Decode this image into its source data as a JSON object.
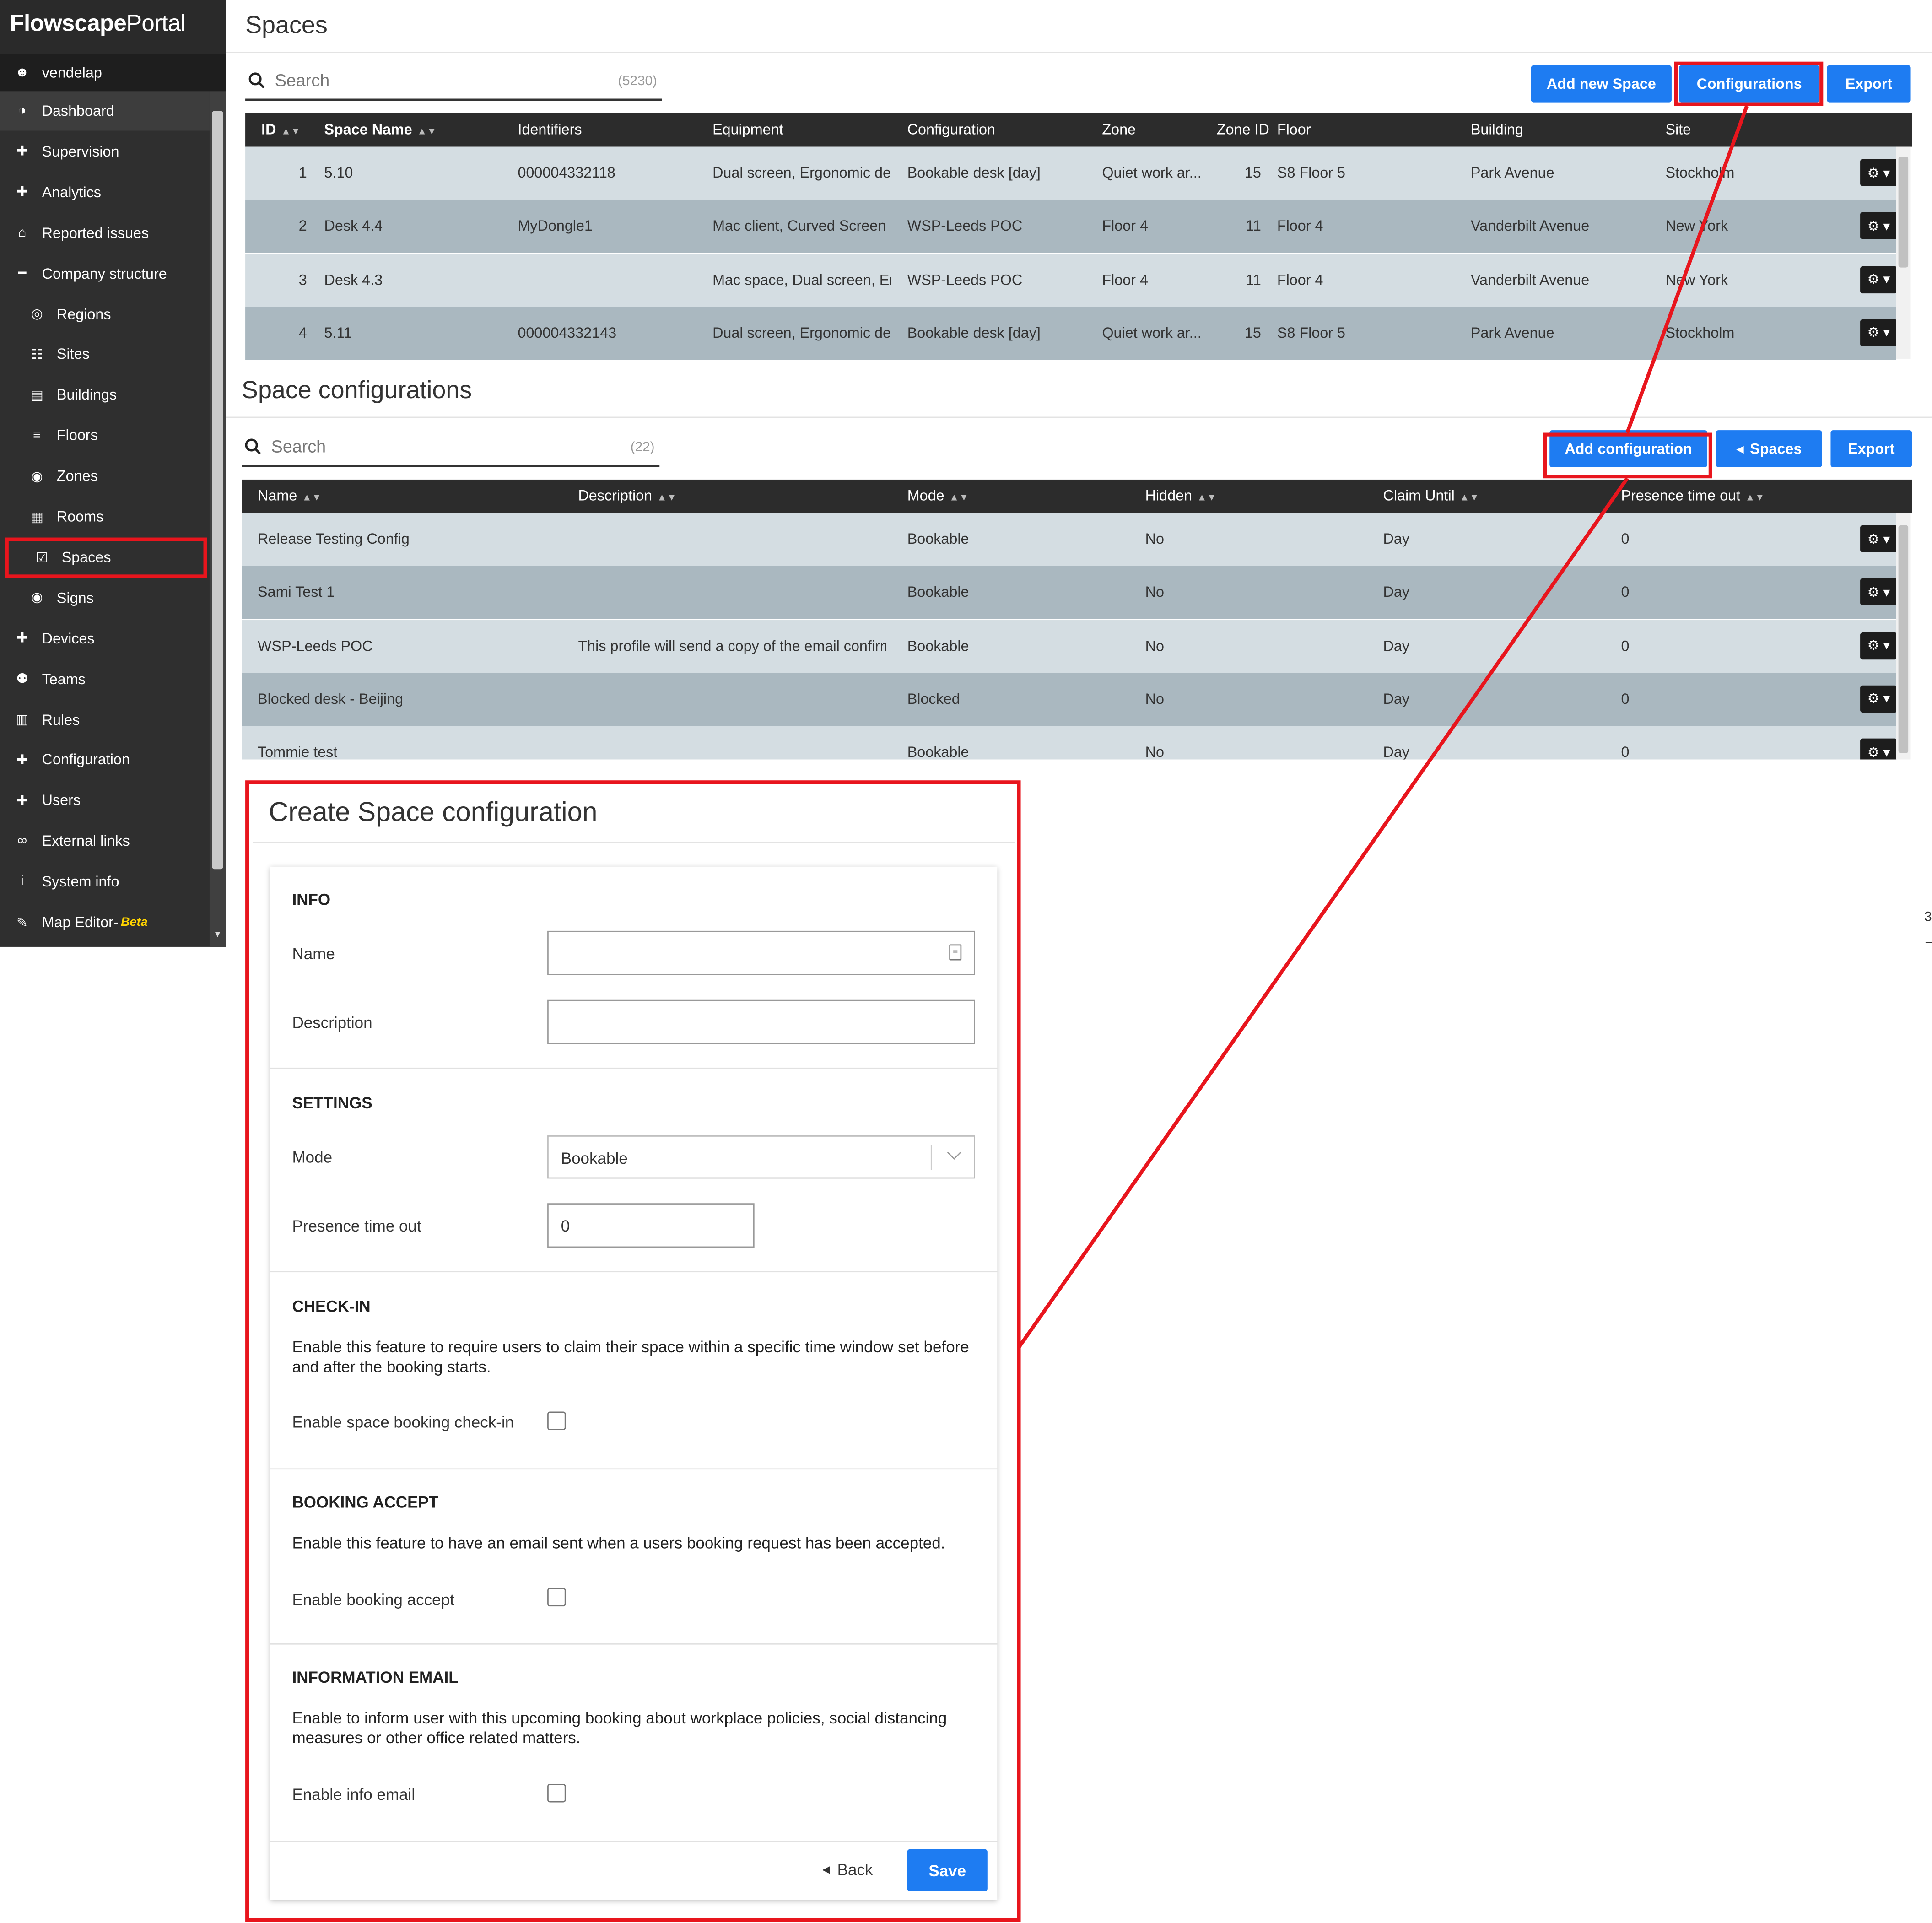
{
  "app": {
    "brand_bold": "Flowscape",
    "brand_light": "Portal",
    "user": "vendelap"
  },
  "sidebar": {
    "items": [
      {
        "label": "Dashboard",
        "icon": "dashboard-icon"
      },
      {
        "label": "Supervision",
        "icon": "plus-icon"
      },
      {
        "label": "Analytics",
        "icon": "plus-icon"
      },
      {
        "label": "Reported issues",
        "icon": "home-icon"
      },
      {
        "label": "Company structure",
        "icon": "minus-icon"
      },
      {
        "label": "Regions",
        "icon": "globe-icon"
      },
      {
        "label": "Sites",
        "icon": "sitemap-icon"
      },
      {
        "label": "Buildings",
        "icon": "building-icon"
      },
      {
        "label": "Floors",
        "icon": "layers-icon"
      },
      {
        "label": "Zones",
        "icon": "map-marker-icon"
      },
      {
        "label": "Rooms",
        "icon": "room-icon"
      },
      {
        "label": "Spaces",
        "icon": "calendar-check-icon"
      },
      {
        "label": "Signs",
        "icon": "map-marker-icon"
      },
      {
        "label": "Devices",
        "icon": "plus-icon"
      },
      {
        "label": "Teams",
        "icon": "users-icon"
      },
      {
        "label": "Rules",
        "icon": "file-icon"
      },
      {
        "label": "Configuration",
        "icon": "plus-icon"
      },
      {
        "label": "Users",
        "icon": "plus-icon"
      },
      {
        "label": "External links",
        "icon": "link-icon"
      },
      {
        "label": "System info",
        "icon": "info-icon"
      },
      {
        "label": "Map Editor-",
        "icon": "edit-icon",
        "badge": "Beta"
      }
    ]
  },
  "spaces": {
    "title": "Spaces",
    "search_placeholder": "Search",
    "search_count": "(5230)",
    "buttons": {
      "add": "Add new Space",
      "configs": "Configurations",
      "export": "Export"
    },
    "columns": [
      "ID",
      "Space Name",
      "Identifiers",
      "Equipment",
      "Configuration",
      "Zone",
      "Zone ID",
      "Floor",
      "Building",
      "Site"
    ],
    "rows": [
      {
        "id": "1",
        "name": "5.10",
        "identifiers": "000004332118",
        "equipment": "Dual screen, Ergonomic de...",
        "configuration": "Bookable desk [day]",
        "zone": "Quiet work ar...",
        "zone_id": "15",
        "floor": "S8 Floor 5",
        "building": "Park Avenue",
        "site": "Stockholm"
      },
      {
        "id": "2",
        "name": "Desk 4.4",
        "identifiers": "MyDongle1",
        "equipment": "Mac client, Curved Screen",
        "configuration": "WSP-Leeds POC",
        "zone": "Floor 4",
        "zone_id": "11",
        "floor": "Floor 4",
        "building": "Vanderbilt Avenue",
        "site": "New York"
      },
      {
        "id": "3",
        "name": "Desk 4.3",
        "identifiers": "",
        "equipment": "Mac space, Dual screen, Er...",
        "configuration": "WSP-Leeds POC",
        "zone": "Floor 4",
        "zone_id": "11",
        "floor": "Floor 4",
        "building": "Vanderbilt Avenue",
        "site": "New York"
      },
      {
        "id": "4",
        "name": "5.11",
        "identifiers": "000004332143",
        "equipment": "Dual screen, Ergonomic de...",
        "configuration": "Bookable desk [day]",
        "zone": "Quiet work ar...",
        "zone_id": "15",
        "floor": "S8 Floor 5",
        "building": "Park Avenue",
        "site": "Stockholm"
      }
    ]
  },
  "configs": {
    "title": "Space configurations",
    "search_placeholder": "Search",
    "search_count": "(22)",
    "buttons": {
      "add": "Add configuration",
      "spaces": "Spaces",
      "export": "Export"
    },
    "columns": [
      "Name",
      "Description",
      "Mode",
      "Hidden",
      "Claim Until",
      "Presence time out"
    ],
    "rows": [
      {
        "name": "Release Testing Config",
        "description": "",
        "mode": "Bookable",
        "hidden": "No",
        "claim": "Day",
        "presence": "0"
      },
      {
        "name": "Sami Test 1",
        "description": "",
        "mode": "Bookable",
        "hidden": "No",
        "claim": "Day",
        "presence": "0"
      },
      {
        "name": "WSP-Leeds POC",
        "description": "This profile will send a copy of the email confirm...",
        "mode": "Bookable",
        "hidden": "No",
        "claim": "Day",
        "presence": "0"
      },
      {
        "name": "Blocked desk - Beijing",
        "description": "",
        "mode": "Blocked",
        "hidden": "No",
        "claim": "Day",
        "presence": "0"
      },
      {
        "name": "Tommie test",
        "description": "",
        "mode": "Bookable",
        "hidden": "No",
        "claim": "Day",
        "presence": "0"
      }
    ]
  },
  "form": {
    "title": "Create Space configuration",
    "info_heading": "INFO",
    "name_label": "Name",
    "name_value": "",
    "description_label": "Description",
    "description_value": "",
    "settings_heading": "SETTINGS",
    "mode_label": "Mode",
    "mode_value": "Bookable",
    "presence_label": "Presence time out",
    "presence_value": "0",
    "checkin_heading": "CHECK-IN",
    "checkin_text": "Enable this feature to require users to claim their space within a specific time window set before and after the booking starts.",
    "checkin_label": "Enable space booking check-in",
    "accept_heading": "BOOKING ACCEPT",
    "accept_text": "Enable this feature to have an email sent when a users booking request has been accepted.",
    "accept_label": "Enable booking accept",
    "email_heading": "INFORMATION EMAIL",
    "email_text": "Enable to inform user with this upcoming booking about workplace policies, social distancing measures or other office related matters.",
    "email_label": "Enable info email",
    "back_label": "Back",
    "save_label": "Save"
  },
  "edge_fragment": "3",
  "colors": {
    "primary": "#1e7cf2",
    "highlight": "#e8151d",
    "sidebar": "#2f2f2f",
    "row_light": "#d4dde2",
    "row_dark": "#aab8c0",
    "beta": "#ffd400"
  }
}
